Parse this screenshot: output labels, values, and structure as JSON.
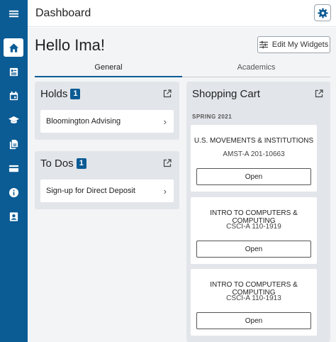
{
  "topbar": {
    "title": "Dashboard",
    "settings_icon": "gear-icon"
  },
  "sidebar": {
    "items": [
      {
        "name": "menu",
        "icon": "hamburger-icon"
      },
      {
        "name": "home",
        "icon": "home-icon",
        "active": true
      },
      {
        "name": "student-center",
        "icon": "id-list-icon"
      },
      {
        "name": "calendar",
        "icon": "calendar-icon"
      },
      {
        "name": "academics",
        "icon": "graduation-cap-icon"
      },
      {
        "name": "documents",
        "icon": "documents-icon"
      },
      {
        "name": "finances",
        "icon": "credit-card-icon"
      },
      {
        "name": "info",
        "icon": "info-icon"
      },
      {
        "name": "profile",
        "icon": "profile-icon"
      }
    ],
    "accent": "#0b5b94"
  },
  "main": {
    "greeting": "Hello Ima!",
    "edit_widgets_label": "Edit My Widgets",
    "tabs": [
      {
        "label": "General",
        "active": true
      },
      {
        "label": "Academics",
        "active": false
      }
    ]
  },
  "holds": {
    "title": "Holds",
    "count": "1",
    "items": [
      {
        "label": "Bloomington Advising"
      }
    ]
  },
  "todos": {
    "title": "To Dos",
    "count": "1",
    "items": [
      {
        "label": "Sign-up for Direct Deposit"
      }
    ]
  },
  "cart": {
    "title": "Shopping Cart",
    "term": "SPRING 2021",
    "courses": [
      {
        "title": "U.S. MOVEMENTS & INSTITUTIONS",
        "code": "AMST-A 201-10663",
        "button": "Open"
      },
      {
        "title": "INTRO TO COMPUTERS & COMPUTING",
        "code": "CSCI-A 110-1919",
        "button": "Open"
      },
      {
        "title": "INTRO TO COMPUTERS & COMPUTING",
        "code": "CSCI-A 110-1913",
        "button": "Open"
      }
    ]
  }
}
